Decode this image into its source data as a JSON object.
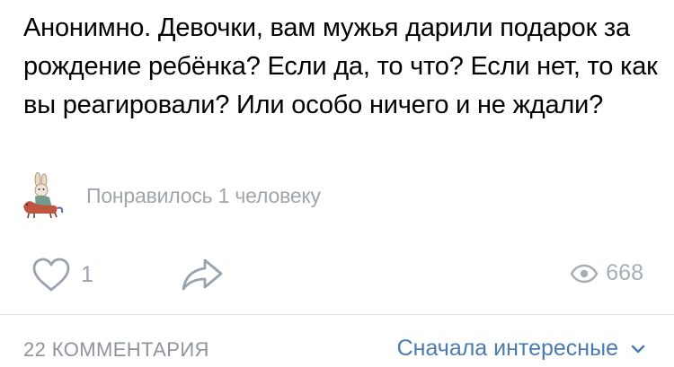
{
  "post": {
    "text": "Анонимно. Девочки, вам мужья дарили подарок за рождение ребёнка? Если да, то что? Если нет, то как вы реагировали? Или особо ничего и не ждали?"
  },
  "likes": {
    "summary": "Понравилось 1 человеку",
    "avatar_icon": "bunny-on-horse-avatar"
  },
  "actions": {
    "like_icon": "heart-icon",
    "like_count": "1",
    "share_icon": "share-arrow-icon",
    "views_icon": "eye-icon",
    "views_count": "668"
  },
  "comments": {
    "count_label": "22 КОММЕНТАРИЯ",
    "sort_label": "Сначала интересные",
    "sort_icon": "chevron-down-icon"
  },
  "colors": {
    "text": "#000000",
    "muted": "#a0a5ab",
    "accent": "#4a7bb0",
    "divider": "#e1e3e6"
  }
}
